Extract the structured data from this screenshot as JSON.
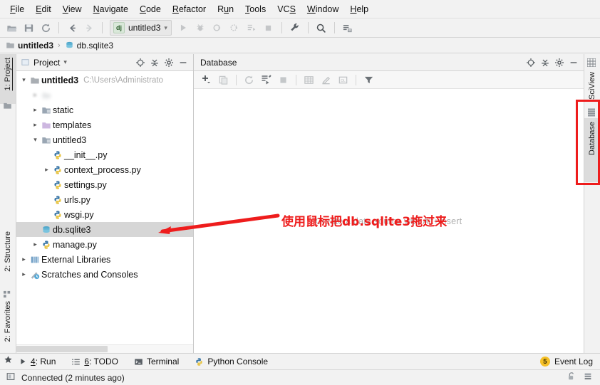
{
  "window": {
    "title": "untitled3"
  },
  "menubar": {
    "items": [
      {
        "label": "File",
        "mnemonic": "F"
      },
      {
        "label": "Edit",
        "mnemonic": "E"
      },
      {
        "label": "View",
        "mnemonic": "V"
      },
      {
        "label": "Navigate",
        "mnemonic": "N"
      },
      {
        "label": "Code",
        "mnemonic": "C"
      },
      {
        "label": "Refactor",
        "mnemonic": "R"
      },
      {
        "label": "Run",
        "mnemonic": "u"
      },
      {
        "label": "Tools",
        "mnemonic": "T"
      },
      {
        "label": "VCS",
        "mnemonic": "S"
      },
      {
        "label": "Window",
        "mnemonic": "W"
      },
      {
        "label": "Help",
        "mnemonic": "H"
      }
    ]
  },
  "toolbar": {
    "open_icon": "open-folder-icon",
    "save_icon": "save-icon",
    "sync_icon": "refresh-icon",
    "back_icon": "arrow-left-icon",
    "forward_icon": "arrow-right-icon",
    "run_config_label": "untitled3",
    "run_config_badge": "dj",
    "run_icon": "run-play-icon",
    "debug_icon": "debug-bug-icon",
    "coverage_icon": "run-coverage-icon",
    "profile_icon": "run-profile-icon",
    "rerun_icon": "run-tests-icon",
    "stop_icon": "stop-square-icon",
    "settings_icon": "wrench-icon",
    "search_icon": "search-icon",
    "updates_icon": "update-project-icon"
  },
  "breadcrumb": {
    "project": "untitled3",
    "separator": "›",
    "file": "db.sqlite3",
    "project_icon": "folder-icon",
    "file_icon": "database-file-icon"
  },
  "left_tool_strip": {
    "tabs": [
      {
        "label": "1: Project",
        "mnemonic": "1",
        "icon": "project-folder-icon",
        "active": true
      },
      {
        "label": "2: Structure",
        "mnemonic": "2",
        "icon": "structure-icon",
        "active": false
      },
      {
        "label": "2: Favorites",
        "mnemonic": "2",
        "icon": "star-icon",
        "active": false
      }
    ]
  },
  "project_panel": {
    "title": "Project",
    "dropdown_icon": "chevron-down-icon",
    "locate_icon": "crosshair-target-icon",
    "collapse_icon": "collapse-all-icon",
    "settings_icon": "gear-icon",
    "hide_icon": "minimize-icon",
    "tree": [
      {
        "label": "untitled3",
        "path": "C:\\Users\\Administrato",
        "depth": 0,
        "arrow": "expanded",
        "icon": "folder-icon",
        "bold": true,
        "selected": false,
        "blurred": false
      },
      {
        "label": "",
        "path": "",
        "depth": 1,
        "arrow": "collapsed",
        "icon": "folder-icon",
        "bold": false,
        "selected": false,
        "blurred": true
      },
      {
        "label": "static",
        "path": "",
        "depth": 1,
        "arrow": "collapsed",
        "icon": "folder-src-icon",
        "bold": false,
        "selected": false,
        "blurred": false
      },
      {
        "label": "templates",
        "path": "",
        "depth": 1,
        "arrow": "collapsed",
        "icon": "folder-templates-icon",
        "bold": false,
        "selected": false,
        "blurred": false
      },
      {
        "label": "untitled3",
        "path": "",
        "depth": 1,
        "arrow": "expanded",
        "icon": "folder-src-icon",
        "bold": false,
        "selected": false,
        "blurred": false
      },
      {
        "label": "__init__.py",
        "path": "",
        "depth": 2,
        "arrow": "none",
        "icon": "python-file-icon",
        "bold": false,
        "selected": false,
        "blurred": false
      },
      {
        "label": "context_process.py",
        "path": "",
        "depth": 2,
        "arrow": "collapsed",
        "icon": "python-file-icon",
        "bold": false,
        "selected": false,
        "blurred": false
      },
      {
        "label": "settings.py",
        "path": "",
        "depth": 2,
        "arrow": "none",
        "icon": "python-file-icon",
        "bold": false,
        "selected": false,
        "blurred": false
      },
      {
        "label": "urls.py",
        "path": "",
        "depth": 2,
        "arrow": "none",
        "icon": "python-file-icon",
        "bold": false,
        "selected": false,
        "blurred": false
      },
      {
        "label": "wsgi.py",
        "path": "",
        "depth": 2,
        "arrow": "none",
        "icon": "python-file-icon",
        "bold": false,
        "selected": false,
        "blurred": false
      },
      {
        "label": "db.sqlite3",
        "path": "",
        "depth": 1,
        "arrow": "none",
        "icon": "database-file-icon",
        "bold": false,
        "selected": true,
        "blurred": false
      },
      {
        "label": "manage.py",
        "path": "",
        "depth": 1,
        "arrow": "collapsed",
        "icon": "python-file-icon",
        "bold": false,
        "selected": false,
        "blurred": false
      },
      {
        "label": "External Libraries",
        "path": "",
        "depth": 0,
        "arrow": "collapsed",
        "icon": "libraries-icon",
        "bold": false,
        "selected": false,
        "blurred": false
      },
      {
        "label": "Scratches and Consoles",
        "path": "",
        "depth": 0,
        "arrow": "collapsed",
        "icon": "scratches-icon",
        "bold": false,
        "selected": false,
        "blurred": false
      }
    ]
  },
  "database_panel": {
    "title": "Database",
    "toolbar": [
      {
        "icon": "add-plus-icon",
        "name": "add-data-source-button"
      },
      {
        "icon": "copy-icon",
        "name": "duplicate-button"
      },
      {
        "icon": "refresh-icon",
        "name": "refresh-button"
      },
      {
        "icon": "run-sql-icon",
        "name": "run-sql-button"
      },
      {
        "icon": "stop-square-icon",
        "name": "stop-button"
      },
      {
        "icon": "table-grid-icon",
        "name": "open-table-button"
      },
      {
        "icon": "edit-pencil-icon",
        "name": "modify-button"
      },
      {
        "icon": "sql-console-icon",
        "name": "sql-console-button"
      },
      {
        "icon": "filter-funnel-icon",
        "name": "filter-button"
      }
    ],
    "locate_icon": "crosshair-target-icon",
    "collapse_icon": "collapse-all-icon",
    "settings_icon": "gear-icon",
    "hide_icon": "minimize-icon",
    "empty_hint": "Create a data source with Alt+Insert"
  },
  "right_tool_strip": {
    "tabs": [
      {
        "label": "SciView",
        "icon": "sciview-grid-icon",
        "active": false,
        "highlighted": false
      },
      {
        "label": "Database",
        "icon": "database-icon",
        "active": true,
        "highlighted": true
      }
    ]
  },
  "bottom_bar": {
    "items": [
      {
        "label": "4: Run",
        "mnemonic": "4",
        "icon": "run-play-icon"
      },
      {
        "label": "6: TODO",
        "mnemonic": "6",
        "icon": "todo-list-icon"
      },
      {
        "label": "Terminal",
        "mnemonic": "",
        "icon": "terminal-icon"
      },
      {
        "label": "Python Console",
        "mnemonic": "",
        "icon": "python-console-icon"
      }
    ],
    "event_log_label": "Event Log",
    "event_log_count": "5",
    "favorites_star_icon": "star-icon"
  },
  "status_bar": {
    "icon": "sqlite-status-icon",
    "text": "Connected (2 minutes ago)",
    "lock_icon": "unlock-icon",
    "memory_icon": "memory-stack-icon"
  },
  "annotations": {
    "note_text": "使用鼠标把db.sqlite3拖过来",
    "note_color": "#ee1c1c",
    "arrow_name": "red-arrow-pointer",
    "highlight_name": "database-tab-highlight-box"
  }
}
